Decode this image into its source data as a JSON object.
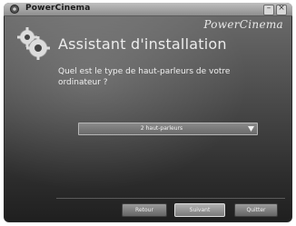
{
  "window": {
    "title": "PowerCinema",
    "brand": "PowerCinema"
  },
  "wizard": {
    "heading": "Assistant d'installation",
    "question": "Quel est le type de haut-parleurs de votre ordinateur ?",
    "speaker_select": {
      "selected": "2 haut-parleurs"
    }
  },
  "buttons": {
    "back": "Retour",
    "next": "Suivant",
    "quit": "Quitter"
  },
  "icons": {
    "app": "gear-icon",
    "dropdown": "chevron-down-icon"
  },
  "colors": {
    "background_top": "#6e6e6e",
    "background_bottom": "#1f1f1f",
    "text": "#ececec"
  }
}
